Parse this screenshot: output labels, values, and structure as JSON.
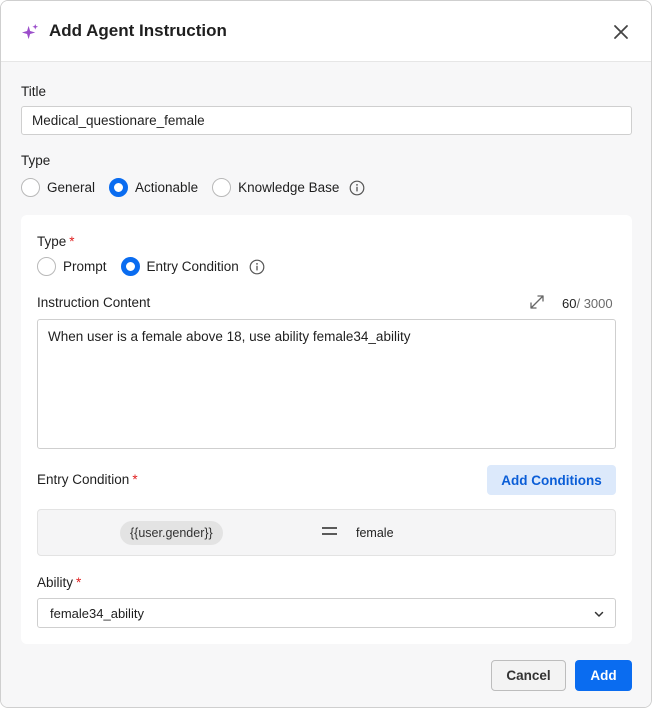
{
  "dialog": {
    "title": "Add Agent Instruction",
    "icon": "sparkle-icon",
    "accent_color": "#9b4dca"
  },
  "title_field": {
    "label": "Title",
    "value": "Medical_questionare_female"
  },
  "type_group": {
    "label": "Type",
    "options": [
      {
        "label": "General",
        "checked": false
      },
      {
        "label": "Actionable",
        "checked": true
      },
      {
        "label": "Knowledge Base",
        "checked": false
      }
    ],
    "info_icon": "info-icon"
  },
  "card": {
    "type_label": "Type",
    "required_mark": "*",
    "type_options": [
      {
        "label": "Prompt",
        "checked": false
      },
      {
        "label": "Entry Condition",
        "checked": true
      }
    ],
    "instruction_label": "Instruction Content",
    "char_count": "60",
    "char_max": "/ 3000",
    "instruction_value": "When user is a female above 18, use ability female34_ability",
    "entry_condition_label": "Entry Condition",
    "add_conditions_label": "Add Conditions",
    "condition": {
      "variable": "{{user.gender}}",
      "operator": "equals",
      "value": "female"
    },
    "ability_label": "Ability",
    "ability_value": "female34_ability"
  },
  "footer": {
    "cancel_label": "Cancel",
    "add_label": "Add"
  },
  "colors": {
    "primary": "#0a6cf0",
    "required": "#e02020",
    "secondary_button_bg": "#dce9fb"
  }
}
